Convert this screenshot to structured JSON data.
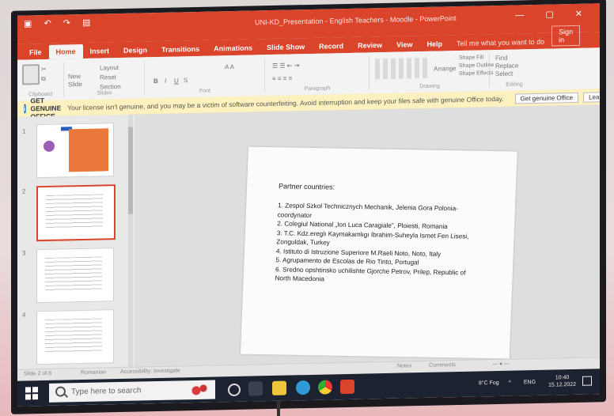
{
  "title_bar": {
    "document_title": "UNI-KD_Presentation - English Teachers - Moodle - PowerPoint",
    "quick_access_icons": [
      "save-icon",
      "undo-icon",
      "redo-icon",
      "start-from-beginning-icon"
    ]
  },
  "ribbon": {
    "tabs": [
      "File",
      "Home",
      "Insert",
      "Design",
      "Transitions",
      "Animations",
      "Slide Show",
      "Record",
      "Review",
      "View",
      "Help"
    ],
    "active_tab": "Home",
    "tell_me": "Tell me what you want to do",
    "sign_in": "Sign in",
    "groups": {
      "clipboard": "Clipboard",
      "slides": "Slides",
      "font": "Font",
      "paragraph": "Paragraph",
      "drawing": "Drawing",
      "editing": "Editing"
    },
    "buttons": {
      "new": "New",
      "slide": "Slide",
      "layout": "Layout",
      "reset": "Reset",
      "section": "Section",
      "arrange": "Arrange",
      "find": "Find",
      "replace": "Replace",
      "select": "Select",
      "shape_fill": "Shape Fill",
      "shape_outline": "Shape Outline",
      "shape_effects": "Shape Effects"
    }
  },
  "notification": {
    "title": "GET GENUINE OFFICE",
    "message": "Your license isn't genuine, and you may be a victim of software counterfeiting. Avoid interruption and keep your files safe with genuine Office today.",
    "button_primary": "Get genuine Office",
    "button_secondary": "Learn more"
  },
  "thumbnails": {
    "numbers": [
      "1",
      "2",
      "3",
      "4"
    ],
    "selected": 2
  },
  "slide": {
    "title": "Partner countries:",
    "items": [
      "1. Zespol Szkol Technicznych Mechanik, Jelenia Gora Polonia- coordynator",
      "2. Colegiul National „Ion Luca Caragiale”, Ploiesti, Romania",
      "3. T.C. Kdz.ereglı Kaymakamlıgı Ibrahim-Suheyla Ismet Fen Lisesi, Zonguldak, Turkey",
      "4. Istituto di Istruzione Superiore M.Raeli Noto, Noto, Italy",
      "5. Agrupamento de Escolas de Rio Tinto, Portugal",
      "6. Sredno opshtinsko uchilishte Gjorche Petrov, Prilep, Republic of North Macedonia"
    ]
  },
  "status_bar": {
    "slide_info": "Slide 2 of 8",
    "language": "Romanian",
    "accessibility": "Accessibility: Investigate",
    "notes": "Notes",
    "comments": "Comments"
  },
  "taskbar": {
    "search_placeholder": "Type here to search",
    "temperature": "8°C Fog",
    "language": "ENG",
    "time": "10:40",
    "date": "15.12.2022"
  },
  "colors": {
    "ribbon_accent": "#d9442b",
    "notification_bg": "#fdf2bf",
    "taskbar_bg": "#1c2230"
  }
}
